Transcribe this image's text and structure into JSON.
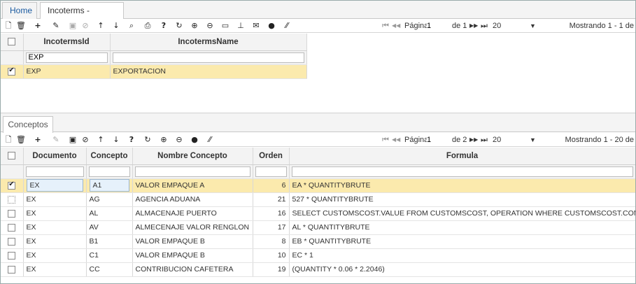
{
  "tabs": [
    {
      "label": "Home"
    },
    {
      "label": "Incoterms -[binc]",
      "close": "×"
    }
  ],
  "toolbar_top": {
    "icons": [
      "new-doc-icon",
      "trash-icon",
      "plus-icon",
      "pencil-icon",
      "save-icon",
      "cancel-icon",
      "arrow-up-icon",
      "arrow-down-icon",
      "zoom-icon",
      "print-icon",
      "help-icon",
      "refresh-icon",
      "zoom-in-icon",
      "zoom-out-icon",
      "comment-icon",
      "pin-icon",
      "mail-icon",
      "add-circle-icon",
      "resize-icon"
    ],
    "pager": {
      "first": "⏮",
      "prev": "◀◀",
      "page_label": "Página",
      "page_value": "1",
      "of_label": "de 1",
      "next": "▶▶",
      "last": "⏭",
      "page_size": "20"
    },
    "status": "Mostrando 1 - 1 de"
  },
  "grid_top": {
    "columns": [
      "IncotermsId",
      "IncotermsName"
    ],
    "filter": {
      "id": "EXP",
      "name": ""
    },
    "rows": [
      {
        "id": "EXP",
        "name": "EXPORTACION",
        "checked": true
      }
    ]
  },
  "section_tab": "Conceptos",
  "toolbar_bottom": {
    "pager": {
      "first": "⏮",
      "prev": "◀◀",
      "page_label": "Página",
      "page_value": "1",
      "of_label": "de 2",
      "next": "▶▶",
      "last": "⏭",
      "page_size": "20"
    },
    "status": "Mostrando 1 - 20 de"
  },
  "grid_bottom": {
    "columns": [
      "Documento",
      "Concepto",
      "Nombre Concepto",
      "Orden",
      "Formula"
    ],
    "rows": [
      {
        "doc": "EX",
        "concepto": "A1",
        "nombre": "VALOR EMPAQUE A",
        "orden": "6",
        "formula": "EA * QUANTITYBRUTE",
        "state": "on"
      },
      {
        "doc": "EX",
        "concepto": "AG",
        "nombre": "AGENCIA ADUANA",
        "orden": "21",
        "formula": "527 * QUANTITYBRUTE",
        "state": "dash"
      },
      {
        "doc": "EX",
        "concepto": "AL",
        "nombre": "ALMACENAJE PUERTO",
        "orden": "16",
        "formula": "SELECT CUSTOMSCOST.VALUE FROM CUSTOMSCOST, OPERATION WHERE CUSTOMSCOST.COMP...",
        "state": "off"
      },
      {
        "doc": "EX",
        "concepto": "AV",
        "nombre": "ALMECENAJE VALOR RENGLON",
        "orden": "17",
        "formula": "AL * QUANTITYBRUTE",
        "state": "off"
      },
      {
        "doc": "EX",
        "concepto": "B1",
        "nombre": "VALOR EMPAQUE B",
        "orden": "8",
        "formula": "EB * QUANTITYBRUTE",
        "state": "off"
      },
      {
        "doc": "EX",
        "concepto": "C1",
        "nombre": "VALOR EMPAQUE B",
        "orden": "10",
        "formula": "EC * 1",
        "state": "off"
      },
      {
        "doc": "EX",
        "concepto": "CC",
        "nombre": "CONTRIBUCION CAFETERA",
        "orden": "19",
        "formula": "(QUANTITY * 0.06 * 2.2046)",
        "state": "off"
      }
    ]
  },
  "colors": {
    "selected_row": "#fbeaad",
    "tab_link": "#1a5aa0"
  }
}
